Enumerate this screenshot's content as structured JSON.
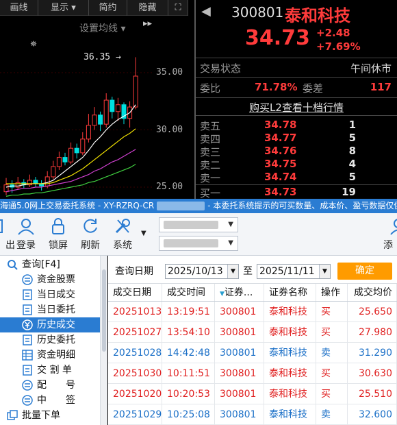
{
  "chart_toolbar": {
    "items": [
      "画线",
      "显示 ▾",
      "简约",
      "隐藏 ▸▸",
      "⛶"
    ]
  },
  "chart": {
    "set_avg_label": "设置均线 ▾",
    "high_label": "36.35 →",
    "price_ticks": [
      "35.00",
      "30.00",
      "25.00"
    ]
  },
  "quote": {
    "code": "300801",
    "name": "泰和科技",
    "price": "34.73",
    "change": "+2.48",
    "change_pct": "+7.69%",
    "status_label": "交易状态",
    "status": "午间休市",
    "weibi_label": "委比",
    "weibi": "71.78%",
    "weicha_label": "委差",
    "weicha": "117",
    "l2_link": "购买L2查看十档行情",
    "orderbook": [
      {
        "label": "卖五",
        "price": "34.78",
        "vol": "1"
      },
      {
        "label": "卖四",
        "price": "34.77",
        "vol": "5"
      },
      {
        "label": "卖三",
        "price": "34.76",
        "vol": "8"
      },
      {
        "label": "卖二",
        "price": "34.75",
        "vol": "4"
      },
      {
        "label": "卖一",
        "price": "34.74",
        "vol": "5"
      },
      {
        "label": "买一",
        "price": "34.73",
        "vol": "19"
      }
    ]
  },
  "trade": {
    "title_left": "海通5.0网上交易委托系统 - XY-RZRQ-CR",
    "title_right": "- 本委托系统提示的可买数量、成本价、盈亏数据仅供",
    "toolbar": [
      "出",
      "登录",
      "锁屏",
      "刷新",
      "系统",
      "添"
    ],
    "sidebar": [
      {
        "label": "查询[F4]",
        "icon": "search-icon"
      },
      {
        "label": "资金股票",
        "icon": "list-icon"
      },
      {
        "label": "当日成交",
        "icon": "doc-icon"
      },
      {
        "label": "当日委托",
        "icon": "doc-icon"
      },
      {
        "label": "历史成交",
        "icon": "yen-icon"
      },
      {
        "label": "历史委托",
        "icon": "doc-icon"
      },
      {
        "label": "资金明细",
        "icon": "grid-icon"
      },
      {
        "label": "交 割 单",
        "icon": "doc-icon"
      },
      {
        "label": "配　　号",
        "icon": "list-icon"
      },
      {
        "label": "中　　签",
        "icon": "list-icon"
      },
      {
        "label": "批量下单",
        "icon": "batch-icon"
      }
    ],
    "filter": {
      "label": "查询日期",
      "from": "2025/10/13",
      "to_label": "至",
      "to": "2025/11/11",
      "confirm": "确定"
    },
    "table": {
      "headers": [
        "成交日期",
        "成交时间",
        "证券...",
        "证券名称",
        "操作",
        "成交均价"
      ],
      "rows": [
        [
          "20251013",
          "13:19:51",
          "300801",
          "泰和科技",
          "买",
          "25.650"
        ],
        [
          "20251027",
          "13:54:10",
          "300801",
          "泰和科技",
          "买",
          "27.980"
        ],
        [
          "20251028",
          "14:42:48",
          "300801",
          "泰和科技",
          "卖",
          "31.290"
        ],
        [
          "20251030",
          "10:11:51",
          "300801",
          "泰和科技",
          "买",
          "30.630"
        ],
        [
          "20251020",
          "10:20:53",
          "300801",
          "泰和科技",
          "买",
          "25.510"
        ],
        [
          "20251029",
          "10:25:08",
          "300801",
          "泰和科技",
          "卖",
          "32.600"
        ]
      ]
    }
  }
}
